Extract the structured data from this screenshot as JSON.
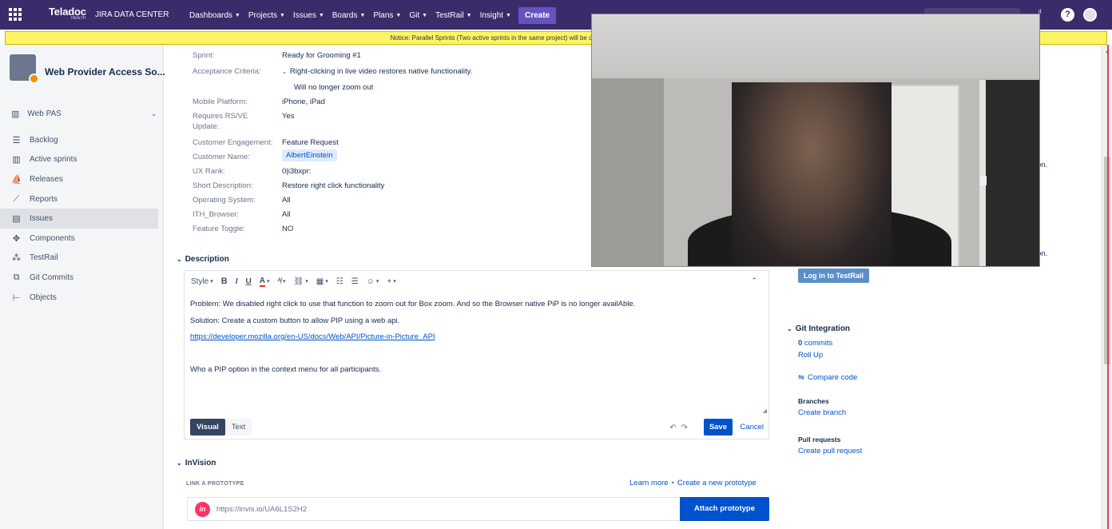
{
  "header": {
    "logo_text": "Teladoc",
    "logo_sub": "HEALTH",
    "site_name": "JIRA DATA CENTER",
    "menu": [
      "Dashboards",
      "Projects",
      "Issues",
      "Boards",
      "Plans",
      "Git",
      "TestRail",
      "Insight"
    ],
    "create_label": "Create"
  },
  "notice": "Notice: Parallel Sprints (Two active sprints in the same project) will be disabled soon. Please create a Request ticket i",
  "sidebar": {
    "project_name": "Web Provider Access So...",
    "board_name": "Web PAS",
    "items": [
      {
        "label": "Backlog",
        "icon": "backlog-icon"
      },
      {
        "label": "Active sprints",
        "icon": "board-icon"
      },
      {
        "label": "Releases",
        "icon": "ship-icon"
      },
      {
        "label": "Reports",
        "icon": "chart-icon"
      },
      {
        "label": "Issues",
        "icon": "issues-icon",
        "active": true
      },
      {
        "label": "Components",
        "icon": "puzzle-icon"
      },
      {
        "label": "TestRail",
        "icon": "testrail-icon"
      },
      {
        "label": "Git Commits",
        "icon": "git-icon"
      },
      {
        "label": "Objects",
        "icon": "tree-icon"
      }
    ]
  },
  "fields": {
    "sprint": {
      "label": "Sprint:",
      "value": "Ready for Grooming #1"
    },
    "acceptance": {
      "label": "Acceptance Criteria:",
      "value": "Right-clicking in live video restores native functionality.",
      "value2": "Will no longer zoom out"
    },
    "mobile": {
      "label": "Mobile Platform:",
      "value": "iPhone, iPad"
    },
    "rsve": {
      "label": "Requires RS/VE",
      "label2": "Update:",
      "value": "Yes"
    },
    "engagement": {
      "label": "Customer Engagement:",
      "value": "Feature Request"
    },
    "customer": {
      "label": "Customer Name:",
      "value": "AlbertEinstein"
    },
    "uxrank": {
      "label": "UX Rank:",
      "value": "0|i3bxpr:"
    },
    "shortdesc": {
      "label": "Short Description:",
      "value": "Restore right click functionality"
    },
    "os": {
      "label": "Operating System:",
      "value": "All"
    },
    "browser": {
      "label": "ITH_Browser:",
      "value": "All"
    },
    "toggle": {
      "label": "Feature Toggle:",
      "value": "NO"
    }
  },
  "description": {
    "title": "Description",
    "toolbar": {
      "style": "Style",
      "bold": "B",
      "italic": "I",
      "underline": "U",
      "color": "A"
    },
    "lines": [
      "Problem:  We disabled right click to use that function to zoom out for Box zoom.  And so the Browser native PiP is no longer availAble.",
      "Solution:  Create a custom button to allow PIP using a web api.",
      "https://developer.mozilla.org/en-US/docs/Web/API/Picture-in-Picture_API",
      "",
      "Who a PIP option in the context menu for all participants."
    ],
    "visual_tab": "Visual",
    "text_tab": "Text",
    "save_label": "Save",
    "cancel_label": "Cancel"
  },
  "invision": {
    "title": "InVision",
    "link_label": "LINK A PROTOTYPE",
    "learn_more": "Learn more",
    "create_prototype": "Create a new prototype",
    "logo": "in",
    "url": "https://invis.io/UA6L1S2H2",
    "attach_label": "Attach prototype"
  },
  "right_panel": {
    "cut_text_1": "on.",
    "cut_text_2": "on.",
    "testrail_button": "Log in to TestRail",
    "git_title": "Git Integration",
    "commits_count": "0",
    "commits_label": " commits",
    "rollup": "Roll Up",
    "compare_code": "Compare code",
    "branches_title": "Branches",
    "create_branch": "Create branch",
    "pr_title": "Pull requests",
    "create_pr": "Create pull request"
  },
  "colors": {
    "nav_bg": "#3b2b6b",
    "notice_bg": "#fdf564",
    "primary": "#0052cc",
    "create_btn": "#6554c0"
  }
}
